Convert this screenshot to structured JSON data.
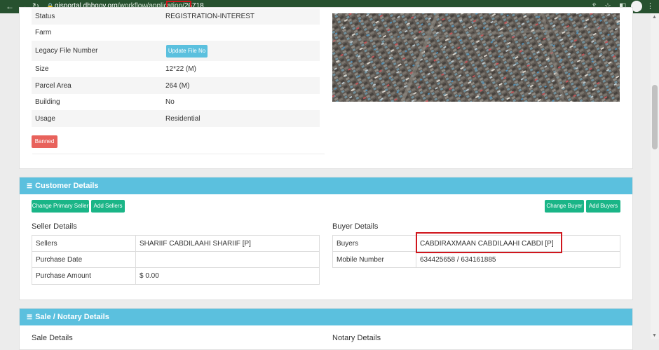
{
  "browser": {
    "url_host": "gisportal.dhhgov.org",
    "url_path": "/workflow/application/",
    "url_id": "26718"
  },
  "property": {
    "rows": [
      {
        "label": "Status",
        "value": "REGISTRATION-INTEREST"
      },
      {
        "label": "Farm",
        "value": ""
      },
      {
        "label": "Legacy File Number",
        "value": ""
      },
      {
        "label": "Size",
        "value": "12*22 (M)"
      },
      {
        "label": "Parcel Area",
        "value": "264 (M)"
      },
      {
        "label": "Building",
        "value": "No"
      },
      {
        "label": "Usage",
        "value": "Residential"
      }
    ],
    "update_file_label": "Update File No",
    "banned_label": "Banned"
  },
  "customer": {
    "title": "Customer Details",
    "buttons": {
      "change_primary_seller": "Change Primary Seller",
      "add_sellers": "Add Sellers",
      "change_buyer": "Change Buyer",
      "add_buyers": "Add Buyers"
    },
    "seller": {
      "title": "Seller Details",
      "rows": [
        {
          "label": "Sellers",
          "value": "SHARIIF CABDILAAHI SHARIIF [P]"
        },
        {
          "label": "Purchase Date",
          "value": ""
        },
        {
          "label": "Purchase Amount",
          "value": "$ 0.00"
        }
      ]
    },
    "buyer": {
      "title": "Buyer Details",
      "rows": [
        {
          "label": "Buyers",
          "value": "CABDIRAXMAAN CABDILAAHI CABDI [P]"
        },
        {
          "label": "Mobile Number",
          "value": "634425658 / 634161885"
        }
      ]
    }
  },
  "sale": {
    "title": "Sale / Notary Details",
    "sale_sub": "Sale Details",
    "notary_sub": "Notary Details"
  },
  "colors": {
    "browser_bar": "#27512f",
    "header_blue": "#5bc0de",
    "button_green": "#1ab587",
    "banned_red": "#e8625c",
    "highlight_red": "#d0161d"
  }
}
